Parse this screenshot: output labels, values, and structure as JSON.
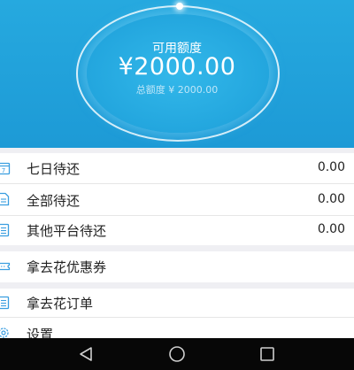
{
  "credit": {
    "available_label": "可用额度",
    "available_amount": "¥2000.00",
    "total_text": "总额度 ¥ 2000.00"
  },
  "menu": {
    "seven_day": {
      "label": "七日待还",
      "value": "0.00",
      "icon": "calendar-icon"
    },
    "all_due": {
      "label": "全部待还",
      "value": "0.00",
      "icon": "document-icon"
    },
    "other_platform": {
      "label": "其他平台待还",
      "value": "0.00",
      "icon": "list-icon"
    },
    "coupons": {
      "label": "拿去花优惠券",
      "icon": "ticket-icon"
    },
    "orders": {
      "label": "拿去花订单",
      "icon": "list-icon"
    },
    "settings": {
      "label": "设置",
      "icon": "gear-icon"
    }
  },
  "navbar": {
    "back": "back-icon",
    "home": "home-icon",
    "recents": "recents-icon"
  },
  "colors": {
    "header_blue": "#1d9ad6",
    "icon_blue": "#3a9ee0"
  }
}
